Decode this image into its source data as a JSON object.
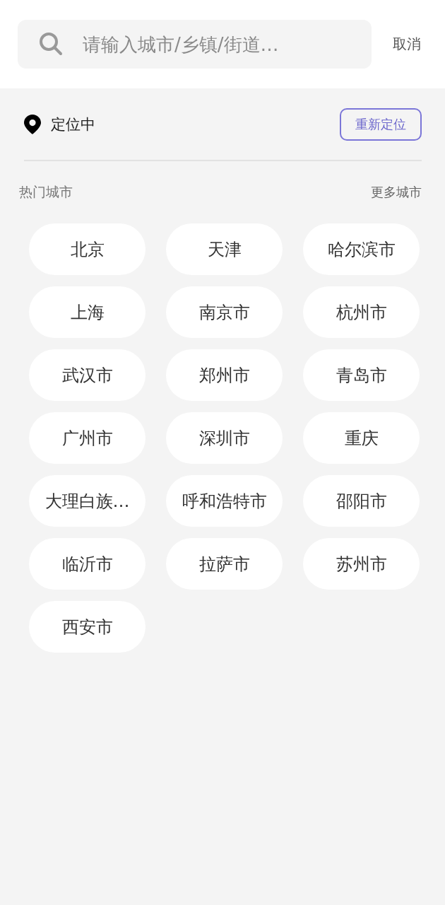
{
  "search": {
    "placeholder": "请输入城市/乡镇/街道…",
    "cancel": "取消"
  },
  "location": {
    "status": "定位中",
    "relocate": "重新定位"
  },
  "hot_cities": {
    "title": "热门城市",
    "more": "更多城市",
    "cities": [
      "北京",
      "天津",
      "哈尔滨市",
      "上海",
      "南京市",
      "杭州市",
      "武汉市",
      "郑州市",
      "青岛市",
      "广州市",
      "深圳市",
      "重庆",
      "大理白族…",
      "呼和浩特市",
      "邵阳市",
      "临沂市",
      "拉萨市",
      "苏州市",
      "西安市"
    ]
  }
}
